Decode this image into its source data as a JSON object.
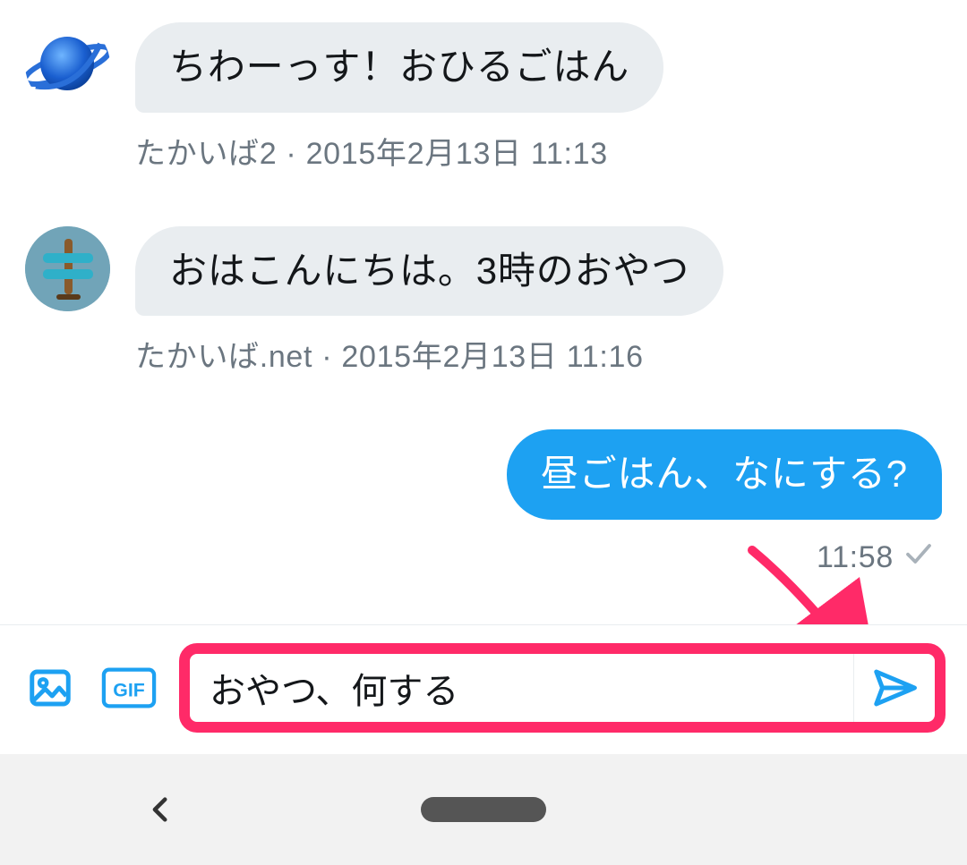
{
  "messages": [
    {
      "kind": "incoming",
      "avatar_kind": "saturn",
      "text": "ちわーっす！おひるごはん",
      "meta": "たかいば2 · 2015年2月13日 11:13"
    },
    {
      "kind": "incoming",
      "avatar_kind": "signpost",
      "text": "おはこんにちは。3時のおやつ",
      "meta": "たかいば.net · 2015年2月13日 11:16"
    },
    {
      "kind": "outgoing",
      "text": "昼ごはん、なにする?",
      "time": "11:58"
    }
  ],
  "composer": {
    "value": "おやつ、何する"
  },
  "icons": {
    "image": "image-icon",
    "gif_label": "GIF",
    "send": "send-icon",
    "back": "back-icon"
  },
  "colors": {
    "accent": "#1da1f2",
    "highlight": "#ff2a68",
    "bubble_in": "#e9edf0",
    "muted": "#6b7680"
  }
}
